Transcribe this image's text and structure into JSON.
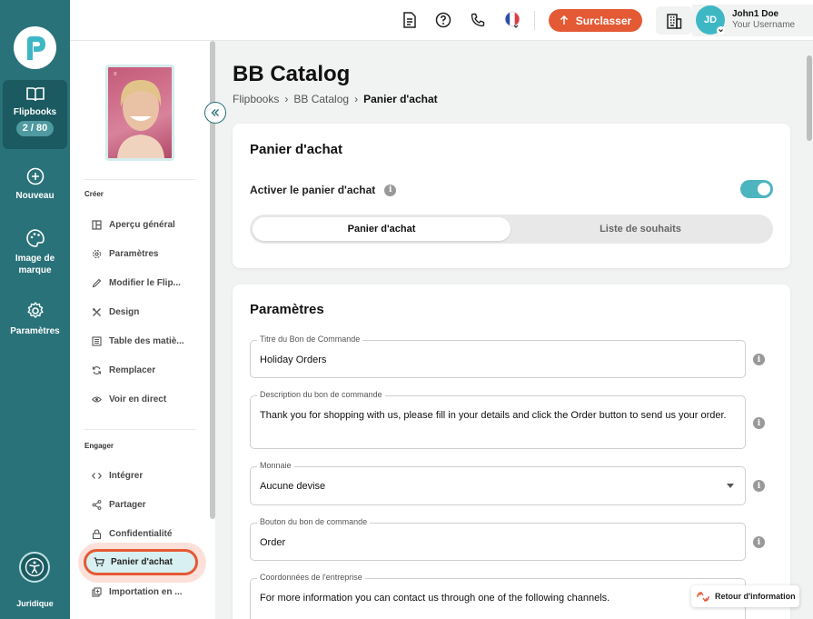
{
  "rail": {
    "flipbooks_label": "Flipbooks",
    "flipbooks_count": "2 / 80",
    "new_label": "Nouveau",
    "brand_label": "Image de marque",
    "params_label": "Paramètres",
    "legal_label": "Juridique"
  },
  "topbar": {
    "upgrade_label": "Surclasser",
    "avatar_initials": "JD",
    "user_name": "John1 Doe",
    "user_sub": "Your Username"
  },
  "sidebar": {
    "create_title": "Créer",
    "create_items": [
      "Aperçu général",
      "Paramètres",
      "Modifier le Flip...",
      "Design",
      "Table des matiè...",
      "Remplacer",
      "Voir en direct"
    ],
    "engage_title": "Engager",
    "engage_items": [
      "Intégrer",
      "Partager",
      "Confidentialité"
    ],
    "active_item": "Panier d'achat",
    "last_item": "Importation en ..."
  },
  "main": {
    "title": "BB Catalog",
    "breadcrumb": [
      "Flipbooks",
      "BB Catalog",
      "Panier d'achat"
    ],
    "cart_card": {
      "title": "Panier d'achat",
      "enable_label": "Activer le panier d'achat",
      "enabled": true,
      "tabs": [
        "Panier d'achat",
        "Liste de souhaits"
      ]
    },
    "settings_card": {
      "title": "Paramètres",
      "fields": [
        {
          "label": "Titre du Bon de Commande",
          "value": "Holiday Orders"
        },
        {
          "label": "Description du bon de commande",
          "value": "Thank you for shopping with us, please fill in your details and click the Order button to send us your order."
        },
        {
          "label": "Monnaie",
          "value": "Aucune devise"
        },
        {
          "label": "Bouton du bon de commande",
          "value": "Order"
        },
        {
          "label": "Coordonnées de l'entreprise",
          "value": "For more information you can contact us through one of the following channels."
        }
      ]
    }
  },
  "feedback_label": "Retour d'information",
  "colors": {
    "rail": "#2a7279",
    "accent": "#e45a35",
    "teal": "#4db5bf"
  },
  "icons": [
    "book-icon",
    "plus-circle-icon",
    "palette-icon",
    "gear-icon",
    "accessibility-icon",
    "document-icon",
    "help-icon",
    "phone-icon",
    "flag-fr-icon",
    "arrow-up-icon",
    "building-icon",
    "chevron-double-left-icon",
    "cart-icon",
    "info-icon",
    "dropdown-caret-icon",
    "feedback-icon"
  ]
}
